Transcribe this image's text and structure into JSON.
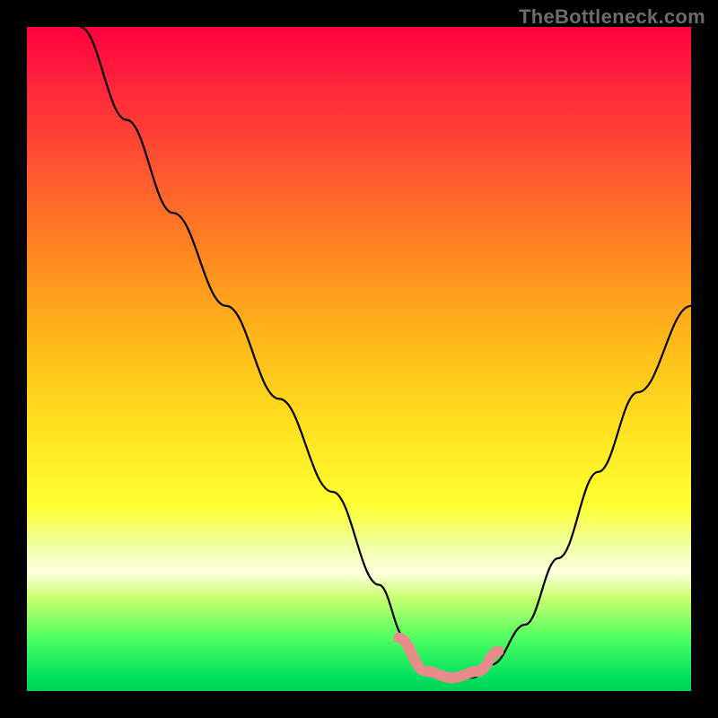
{
  "watermark": "TheBottleneck.com",
  "chart_data": {
    "type": "line",
    "title": "",
    "xlabel": "",
    "ylabel": "",
    "xlim": [
      0,
      100
    ],
    "ylim": [
      0,
      100
    ],
    "grid": false,
    "legend": false,
    "series": [
      {
        "name": "bottleneck-curve",
        "x": [
          8,
          15,
          22,
          30,
          38,
          46,
          53,
          57,
          60,
          63,
          67,
          70,
          75,
          80,
          86,
          92,
          100
        ],
        "y": [
          100,
          86,
          72,
          58,
          44,
          30,
          16,
          8,
          3,
          2,
          2,
          4,
          10,
          20,
          33,
          45,
          58
        ]
      }
    ],
    "highlight": {
      "name": "optimal-range",
      "x": [
        56,
        60,
        64,
        68,
        71
      ],
      "y": [
        8,
        3,
        2,
        3,
        6
      ]
    },
    "gradient_stops": [
      {
        "pos": 0,
        "color": "#ff0040"
      },
      {
        "pos": 35,
        "color": "#ff8a20"
      },
      {
        "pos": 72,
        "color": "#ffff30"
      },
      {
        "pos": 100,
        "color": "#00d050"
      }
    ]
  }
}
